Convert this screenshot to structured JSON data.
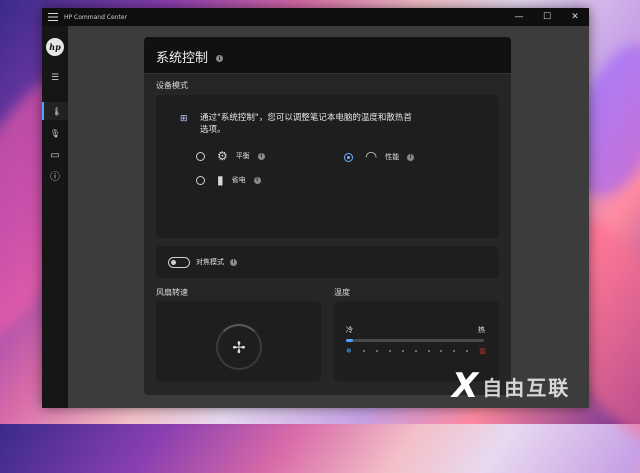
{
  "window": {
    "title": "HP Command Center",
    "controls": {
      "minimize": "—",
      "maximize": "☐",
      "close": "✕"
    }
  },
  "sidebar": {
    "logo": "hp",
    "items": [
      {
        "icon": "hamburger-icon",
        "glyph": "☰"
      },
      {
        "icon": "thermometer-fan-icon",
        "glyph": "🌡"
      },
      {
        "icon": "microphone-icon",
        "glyph": "🎙"
      },
      {
        "icon": "display-info-icon",
        "glyph": "▭"
      },
      {
        "icon": "info-icon",
        "glyph": "ⓘ"
      }
    ]
  },
  "panel": {
    "title": "系统控制",
    "device_mode": {
      "label": "设备模式",
      "description": "通过\"系统控制\"，您可以调整笔记本电脑的温度和散热首选项。",
      "modes": [
        {
          "label": "平衡",
          "icon": "gears-icon",
          "glyph": "⚙",
          "selected": false
        },
        {
          "label": "性能",
          "icon": "speedometer-icon",
          "glyph": "◠",
          "selected": true
        },
        {
          "label": "省电",
          "icon": "battery-icon",
          "glyph": "▮",
          "selected": false
        }
      ]
    },
    "focus_mode": {
      "label": "对焦模式",
      "enabled": false
    },
    "fan_speed": {
      "label": "风扇转速",
      "glyph": "✢"
    },
    "temperature": {
      "label": "温度",
      "cold_label": "冷",
      "hot_label": "热",
      "level": 0.05,
      "accent_color": "#4aa3ff",
      "cold_glyph": "❄",
      "hot_glyph": "▥"
    }
  },
  "watermark": {
    "mark": "X",
    "text": "自由互联"
  }
}
